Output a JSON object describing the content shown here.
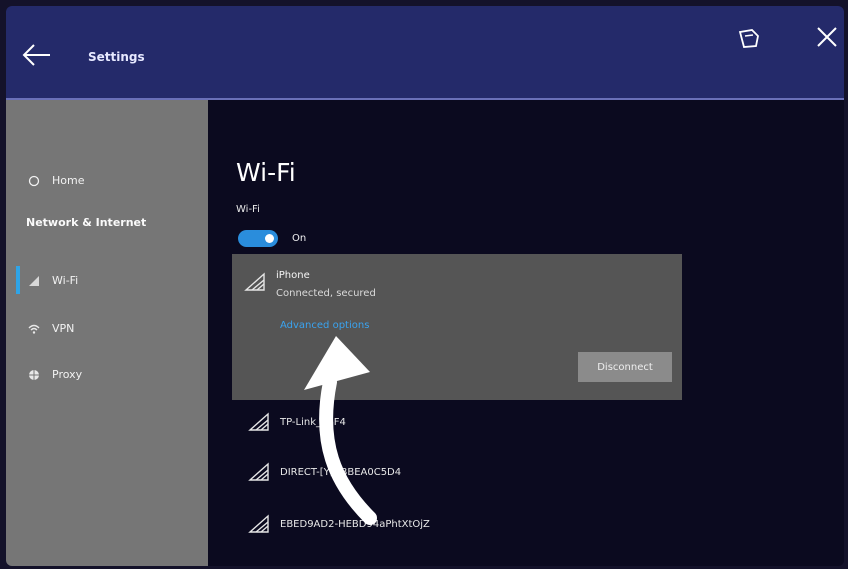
{
  "window": {
    "title": "Settings",
    "icons": [
      "back-arrow-icon",
      "restore-icon",
      "close-icon"
    ]
  },
  "sidebar": {
    "home": "Home",
    "heading": "Network & Internet",
    "items": [
      {
        "label": "Wi-Fi",
        "icon": "wifi-icon",
        "active": true
      },
      {
        "label": "VPN",
        "icon": "vpn-icon",
        "active": false
      },
      {
        "label": "Proxy",
        "icon": "globe-icon",
        "active": false
      }
    ]
  },
  "main": {
    "title": "Wi-Fi",
    "wifi_label": "Wi-Fi",
    "toggle_state": "On",
    "connected_network": {
      "name": "iPhone",
      "status": "Connected, secured",
      "advanced_link": "Advanced options",
      "disconnect_label": "Disconnect"
    },
    "networks": [
      {
        "name": "TP-Link_84F4"
      },
      {
        "name": "DIRECT-[Y]BBBEA0C5D4"
      },
      {
        "name": "EBED9AD2-HEBD94aPhtXtOjZ"
      }
    ]
  },
  "colors": {
    "accent": "#2a8ddc",
    "link": "#3aa3ef",
    "titlebar": "#242a6a",
    "sidebar": "#767676",
    "card": "#555555"
  }
}
